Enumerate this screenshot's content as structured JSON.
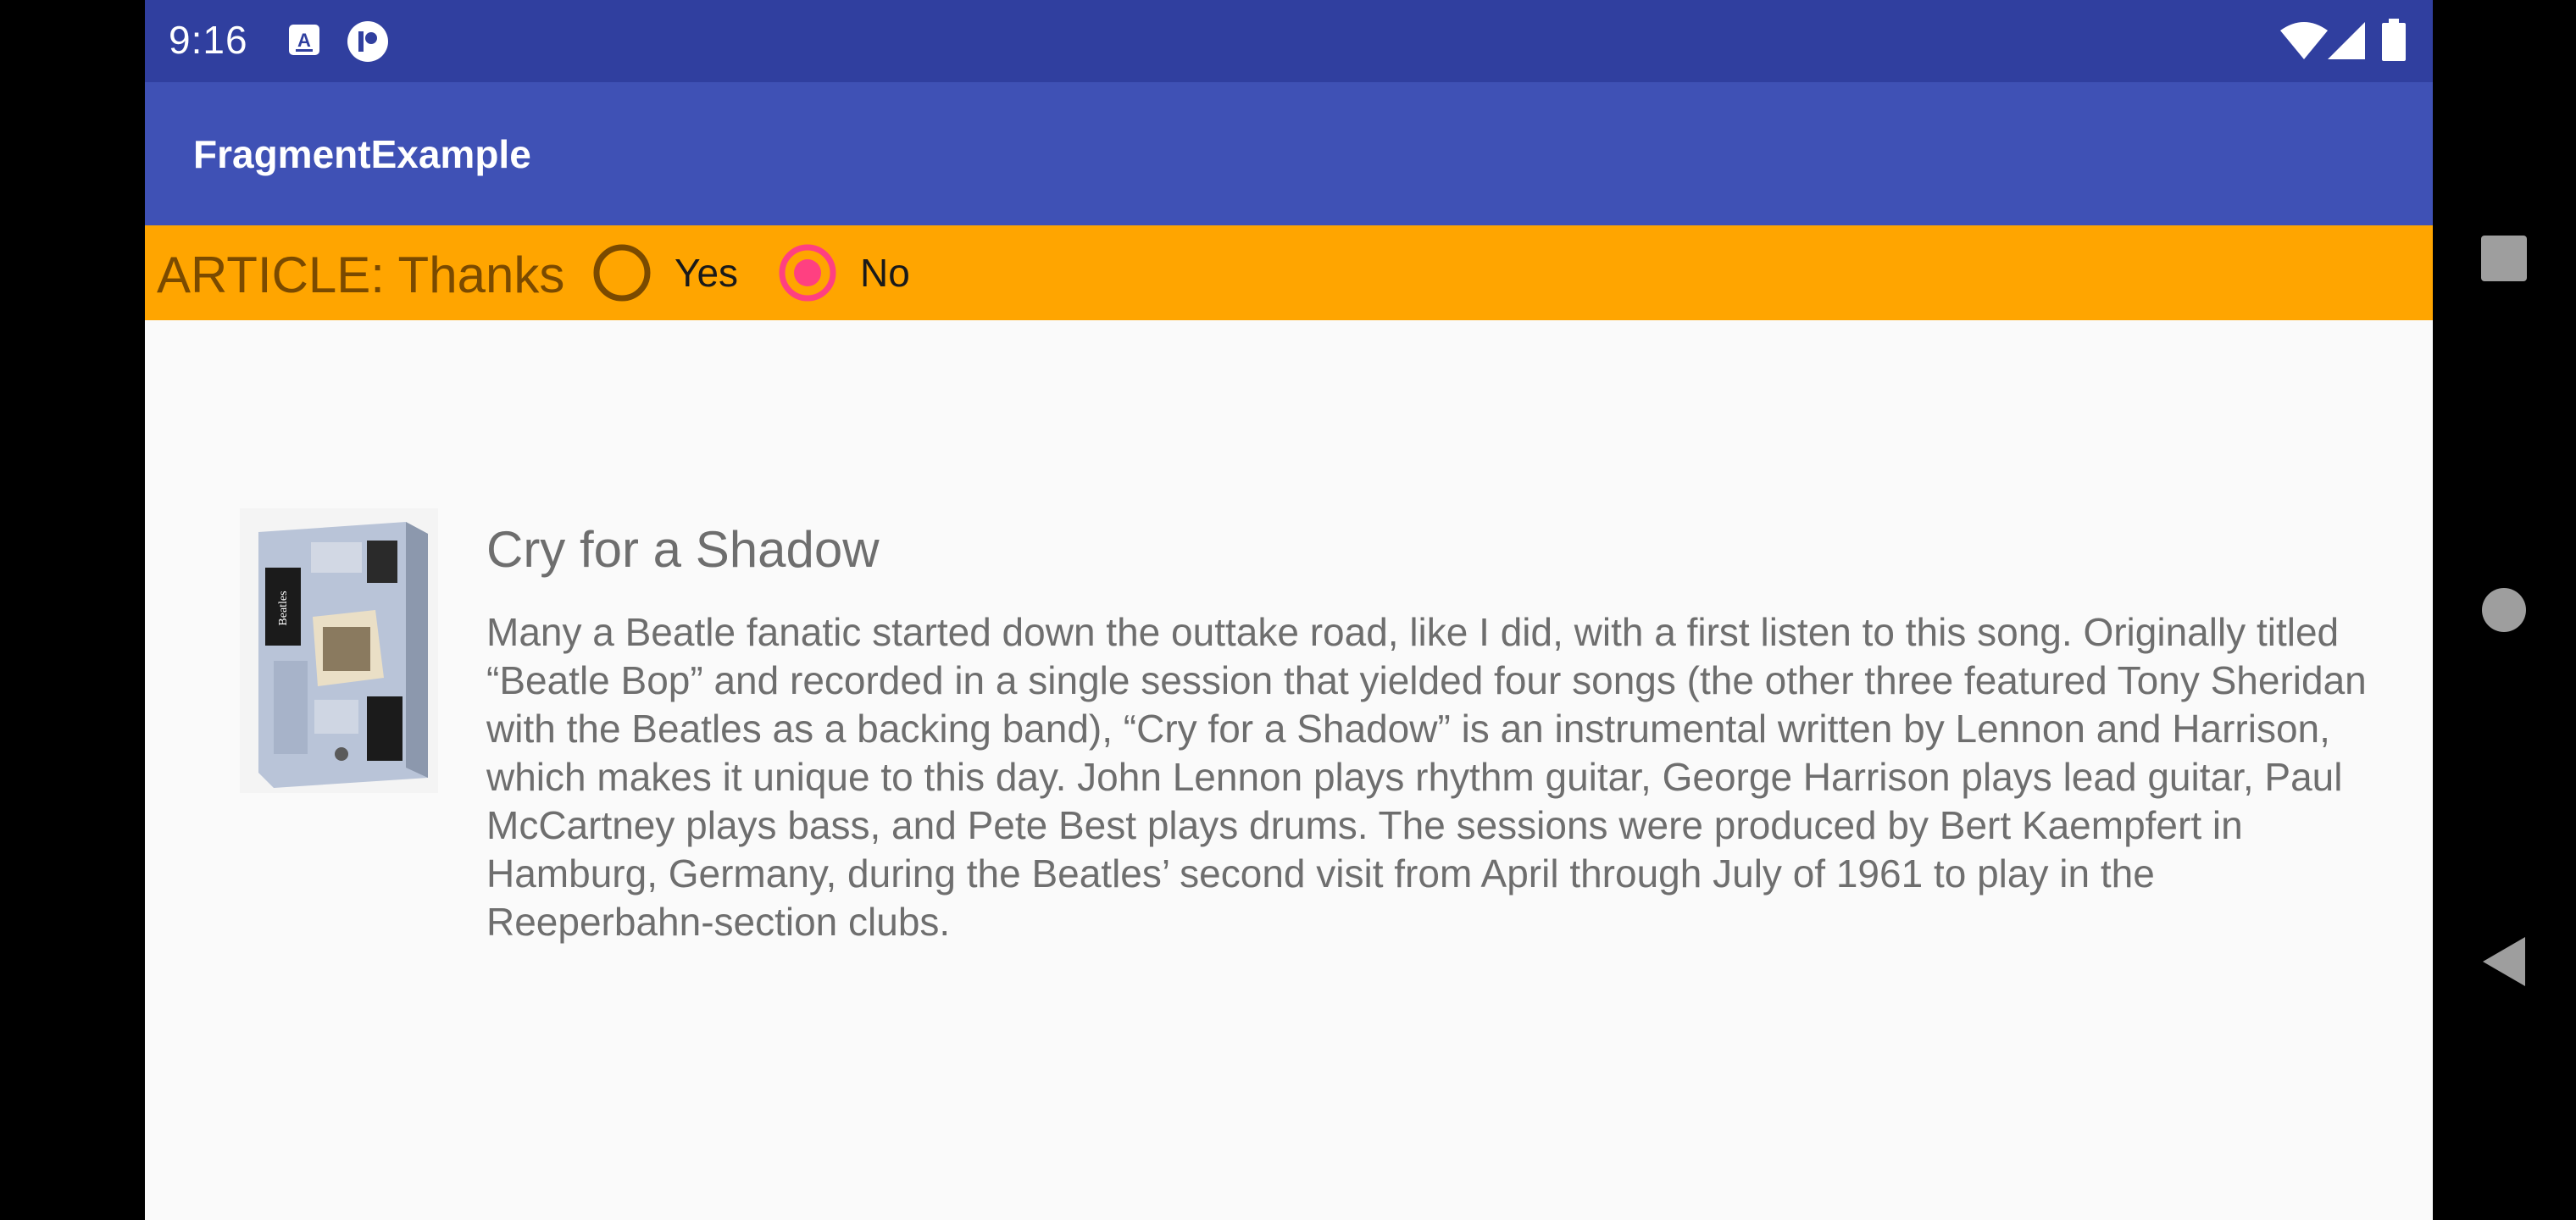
{
  "status_bar": {
    "time": "9:16",
    "icons": [
      "keyboard-icon",
      "sync-icon",
      "wifi-icon",
      "signal-icon",
      "battery-icon"
    ]
  },
  "app_bar": {
    "title": "FragmentExample"
  },
  "article_bar": {
    "label": "ARTICLE: Thanks",
    "options": [
      {
        "label": "Yes",
        "selected": false
      },
      {
        "label": "No",
        "selected": true
      }
    ]
  },
  "song": {
    "title": "Cry for a Shadow",
    "body": "Many a Beatle fanatic started down the outtake road, like I did, with a first listen to this song. Originally titled “Beatle Bop” and recorded in a single session that yielded four songs (the other three featured Tony Sheridan with the Beatles as a backing band), “Cry for a Shadow” is an instrumental written by Lennon and Harrison, which makes it unique to this day. John Lennon plays rhythm guitar, George Harrison plays lead guitar, Paul McCartney plays bass, and Pete Best plays drums. The sessions were produced by Bert Kaempfert in Hamburg, Germany, during the Beatles’ second visit from April through July of 1961 to play in the Reeperbahn-section clubs.",
    "image": "album-cover-image"
  },
  "nav_bar": {
    "buttons": [
      "recents-button",
      "home-button",
      "back-button"
    ]
  },
  "colors": {
    "status_bar": "#303f9f",
    "app_bar": "#3f51b5",
    "article_bar": "#ffa500",
    "radio_unchecked": "#7a4a00",
    "radio_checked": "#ff4081",
    "background": "#fafafa"
  }
}
